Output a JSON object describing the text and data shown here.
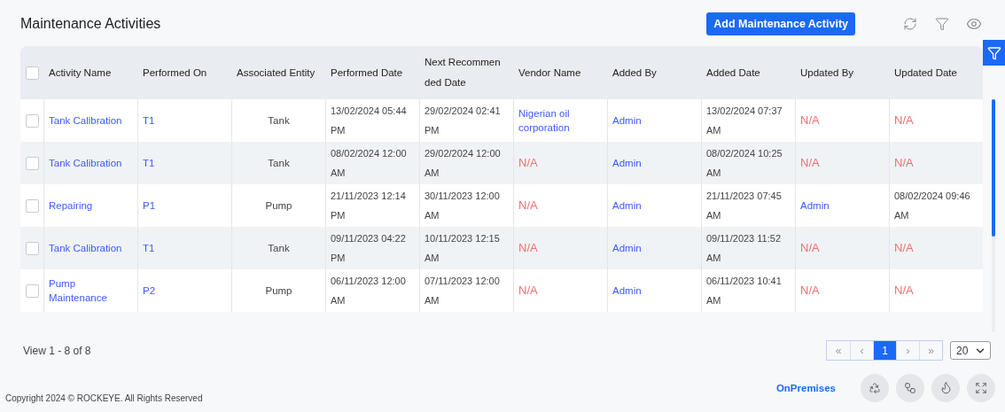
{
  "page": {
    "title": "Maintenance Activities",
    "add_button": "Add Maintenance Activity"
  },
  "table": {
    "select_all": {
      "checked": false
    },
    "columns": [
      "Activity Name",
      "Performed On",
      "Associated Entity",
      "Performed Date",
      "Next Recommen ded Date",
      "Vendor Name",
      "Added By",
      "Added Date",
      "Updated By",
      "Updated Date"
    ],
    "rows": [
      {
        "checked": false,
        "cells": [
          {
            "kind": "link",
            "text": "Tank Calibration"
          },
          {
            "kind": "link",
            "text": "T1"
          },
          {
            "kind": "center",
            "text": "Tank"
          },
          {
            "kind": "text",
            "text": "13/02/2024 05:44 PM"
          },
          {
            "kind": "text",
            "text": "29/02/2024 02:41 PM"
          },
          {
            "kind": "link",
            "text": "Nigerian oil corporation"
          },
          {
            "kind": "link",
            "text": "Admin"
          },
          {
            "kind": "text",
            "text": "13/02/2024 07:37 AM"
          },
          {
            "kind": "na",
            "text": "N/A"
          },
          {
            "kind": "na",
            "text": "N/A"
          }
        ]
      },
      {
        "checked": false,
        "cells": [
          {
            "kind": "link",
            "text": "Tank Calibration"
          },
          {
            "kind": "link",
            "text": "T1"
          },
          {
            "kind": "center",
            "text": "Tank"
          },
          {
            "kind": "text",
            "text": "08/02/2024 12:00 AM"
          },
          {
            "kind": "text",
            "text": "29/02/2024 12:00 AM"
          },
          {
            "kind": "na",
            "text": "N/A"
          },
          {
            "kind": "link",
            "text": "Admin"
          },
          {
            "kind": "text",
            "text": "08/02/2024 10:25 AM"
          },
          {
            "kind": "na",
            "text": "N/A"
          },
          {
            "kind": "na",
            "text": "N/A"
          }
        ]
      },
      {
        "checked": false,
        "cells": [
          {
            "kind": "link",
            "text": "Repairing"
          },
          {
            "kind": "link",
            "text": "P1"
          },
          {
            "kind": "center",
            "text": "Pump"
          },
          {
            "kind": "text",
            "text": "21/11/2023 12:14 PM"
          },
          {
            "kind": "text",
            "text": "30/11/2023 12:00 AM"
          },
          {
            "kind": "na",
            "text": "N/A"
          },
          {
            "kind": "link",
            "text": "Admin"
          },
          {
            "kind": "text",
            "text": "21/11/2023 07:45 AM"
          },
          {
            "kind": "link",
            "text": "Admin"
          },
          {
            "kind": "text",
            "text": "08/02/2024 09:46 AM"
          }
        ]
      },
      {
        "checked": false,
        "cells": [
          {
            "kind": "link",
            "text": "Tank Calibration"
          },
          {
            "kind": "link",
            "text": "T1"
          },
          {
            "kind": "center",
            "text": "Tank"
          },
          {
            "kind": "text",
            "text": "09/11/2023 04:22 PM"
          },
          {
            "kind": "text",
            "text": "10/11/2023 12:15 AM"
          },
          {
            "kind": "na",
            "text": "N/A"
          },
          {
            "kind": "link",
            "text": "Admin"
          },
          {
            "kind": "text",
            "text": "09/11/2023 11:52 AM"
          },
          {
            "kind": "na",
            "text": "N/A"
          },
          {
            "kind": "na",
            "text": "N/A"
          }
        ]
      },
      {
        "checked": false,
        "cells": [
          {
            "kind": "link",
            "text": "Pump Maintenance"
          },
          {
            "kind": "link",
            "text": "P2"
          },
          {
            "kind": "center",
            "text": "Pump"
          },
          {
            "kind": "text",
            "text": "06/11/2023 12:00 AM"
          },
          {
            "kind": "text",
            "text": "07/11/2023 12:00 AM"
          },
          {
            "kind": "na",
            "text": "N/A"
          },
          {
            "kind": "link",
            "text": "Admin"
          },
          {
            "kind": "text",
            "text": "06/11/2023 10:41 AM"
          },
          {
            "kind": "na",
            "text": "N/A"
          },
          {
            "kind": "na",
            "text": "N/A"
          }
        ]
      }
    ]
  },
  "pagination": {
    "summary": "View 1 - 8 of 8",
    "pages": [
      {
        "label": "«",
        "selected": false
      },
      {
        "label": "‹",
        "selected": false
      },
      {
        "label": "1",
        "selected": true
      },
      {
        "label": "›",
        "selected": false
      },
      {
        "label": "»",
        "selected": false
      }
    ],
    "page_size": "20"
  },
  "footer": {
    "copyright": "Copyright 2024 © ROCKEYE. All Rights Reserved",
    "mode": "OnPremises"
  }
}
